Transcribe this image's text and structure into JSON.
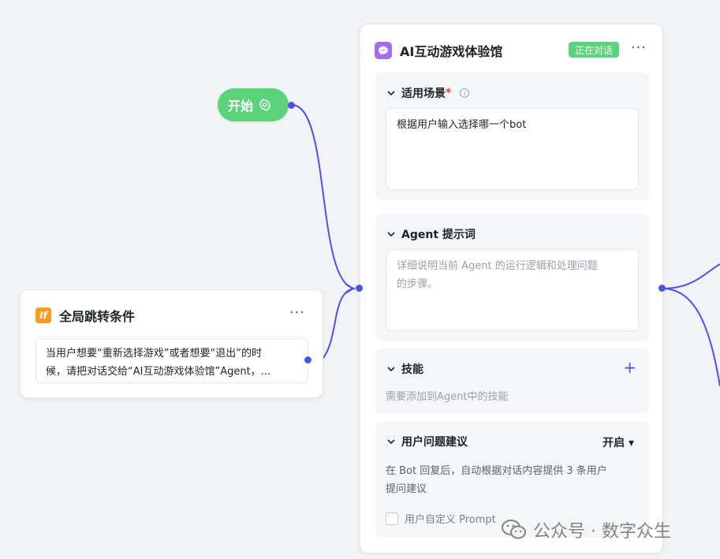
{
  "start": {
    "label": "开始",
    "icon": "gear-icon"
  },
  "condition": {
    "title": "全局跳转条件",
    "icon_text": "If",
    "more": "···",
    "body_line1": "当用户想要“重新选择游戏”或者想要“退出”的时",
    "body_line2": "候，请把对话交给“AI互动游戏体验馆”Agent，..."
  },
  "agent": {
    "title": "AI互动游戏体验馆",
    "status": "正在对话",
    "more": "···",
    "scene": {
      "label": "适用场景",
      "required": "*",
      "info": "i",
      "value": "根据用户输入选择哪一个bot"
    },
    "prompt": {
      "label": "Agent 提示词",
      "placeholder_line1": "详细说明当前 Agent 的运行逻辑和处理问题",
      "placeholder_line2": "的步骤。"
    },
    "skills": {
      "label": "技能",
      "add": "+",
      "hint": "需要添加到Agent中的技能"
    },
    "suggest": {
      "label": "用户问题建议",
      "value": "开启 ▾",
      "desc_line1": "在 Bot 回复后，自动根据对话内容提供 3 条用户",
      "desc_line2": "提问建议",
      "custom_prompt": "用户自定义 Prompt"
    }
  },
  "watermark": "公众号 · 数字众生",
  "colors": {
    "accent": "#4d53e8",
    "green": "#5bd37a",
    "orange": "#ff9a1a",
    "purple": "#a46cf0"
  }
}
